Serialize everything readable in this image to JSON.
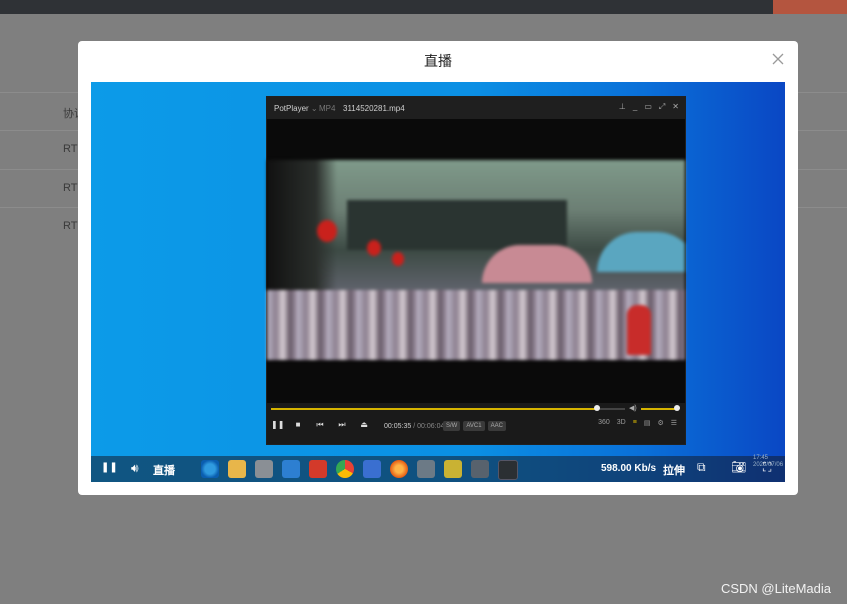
{
  "background": {
    "rows": [
      "协议",
      "RTSP",
      "RTSP",
      "RTSP"
    ]
  },
  "watermark": "CSDN @LiteMadia",
  "modal": {
    "title": "直播",
    "close_icon": "close-icon"
  },
  "potplayer": {
    "app_name": "PotPlayer",
    "app_dropdown": "⌄",
    "format": "MP4",
    "filename": "3114520281.mp4",
    "window_buttons": [
      "pin-icon",
      "minimize-icon",
      "restore-icon",
      "fullscreen-icon",
      "close-icon"
    ],
    "seek_progress": 0.92,
    "volume_level": 1.0,
    "current_time": "00:05:35",
    "time_separator": "/",
    "duration": "00:06:04",
    "tags": [
      "S/W",
      "AVC1",
      "AAC"
    ],
    "right_icons": [
      "360",
      "3D",
      "subtitle-search-icon",
      "playlist-icon",
      "settings-icon",
      "menu-icon"
    ]
  },
  "livebar": {
    "live_label": "直播",
    "bitrate": "598.00 Kb/s",
    "stretch_label": "拉伸",
    "clock_time": "17:45",
    "clock_date": "2023/07/06"
  },
  "colors": {
    "accent_seek": "#d6b400",
    "video_blue": "#0b8fe4"
  }
}
